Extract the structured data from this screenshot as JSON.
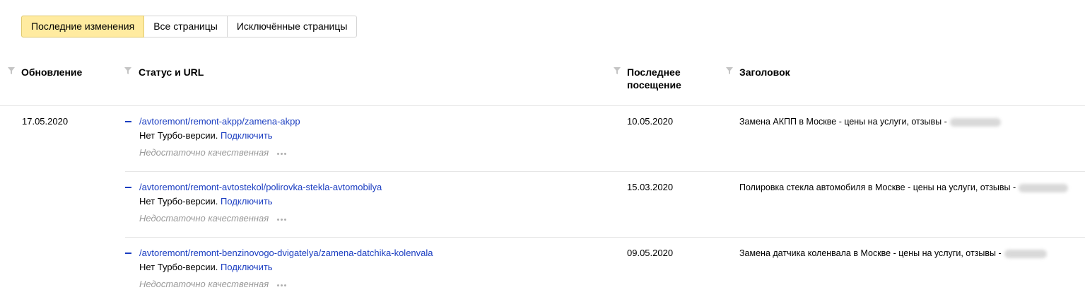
{
  "tabs": [
    {
      "label": "Последние изменения",
      "active": true
    },
    {
      "label": "Все страницы",
      "active": false
    },
    {
      "label": "Исключённые страницы",
      "active": false
    }
  ],
  "columns": {
    "update": "Обновление",
    "status_url": "Статус и URL",
    "last_visit": "Последнее посещение",
    "title": "Заголовок"
  },
  "date_group": "17.05.2020",
  "rows": [
    {
      "url": "/avtoremont/remont-akpp/zamena-akpp",
      "turbo_text": "Нет Турбо-версии.",
      "turbo_link": "Подключить",
      "quality": "Недостаточно качественная",
      "last_visit": "10.05.2020",
      "title": "Замена АКПП в Москве - цены на услуги, отзывы -"
    },
    {
      "url": "/avtoremont/remont-avtostekol/polirovka-stekla-avtomobilya",
      "turbo_text": "Нет Турбо-версии.",
      "turbo_link": "Подключить",
      "quality": "Недостаточно качественная",
      "last_visit": "15.03.2020",
      "title": "Полировка стекла автомобиля в Москве - цены на услуги, отзывы -"
    },
    {
      "url": "/avtoremont/remont-benzinovogo-dvigatelya/zamena-datchika-kolenvala",
      "turbo_text": "Нет Турбо-версии.",
      "turbo_link": "Подключить",
      "quality": "Недостаточно качественная",
      "last_visit": "09.05.2020",
      "title": "Замена датчика коленвала в Москве - цены на услуги, отзывы -"
    }
  ],
  "colors": {
    "accent": "#1a3dc1",
    "active_tab": "#ffeba0",
    "muted": "#999999"
  }
}
